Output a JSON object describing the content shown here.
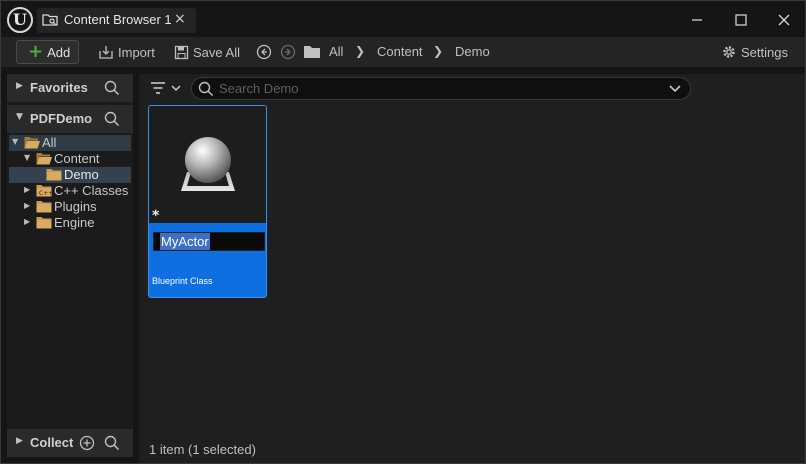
{
  "window": {
    "tab_title": "Content Browser 1",
    "tab_close": "×",
    "logo_letter": "U"
  },
  "toolbar": {
    "add_label": "Add",
    "import_label": "Import",
    "save_all_label": "Save All",
    "breadcrumb": [
      "All",
      "Content",
      "Demo"
    ],
    "settings_label": "Settings"
  },
  "sidebar": {
    "favorites_label": "Favorites",
    "project_label": "PDFDemo",
    "collections_label": "Collect",
    "tree": [
      {
        "label": "All",
        "expanded": true
      },
      {
        "label": "Content",
        "expanded": true
      },
      {
        "label": "Demo",
        "selected": true
      },
      {
        "label": "C++ Classes",
        "expanded": false
      },
      {
        "label": "Plugins",
        "expanded": false
      },
      {
        "label": "Engine",
        "expanded": false
      }
    ]
  },
  "main": {
    "search_placeholder": "Search Demo",
    "asset": {
      "name": "MyActor",
      "type": "Blueprint Class",
      "modified_marker": "*"
    },
    "status": "1 item (1 selected)"
  },
  "colors": {
    "selection_blue": "#0d6fe0",
    "add_green": "#4caf3a",
    "folder": "#c69a55"
  }
}
